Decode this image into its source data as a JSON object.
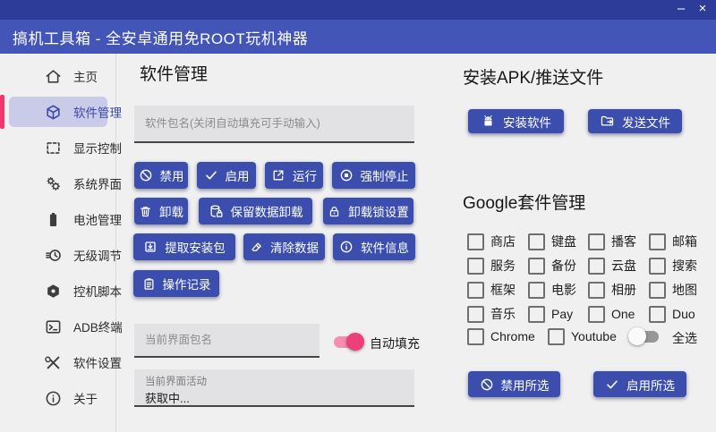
{
  "window": {
    "title": "搞机工具箱 - 全安卓通用免ROOT玩机神器",
    "minimize": "–",
    "close": "×"
  },
  "sidebar": {
    "items": [
      {
        "label": "主页"
      },
      {
        "label": "软件管理"
      },
      {
        "label": "显示控制"
      },
      {
        "label": "系统界面"
      },
      {
        "label": "电池管理"
      },
      {
        "label": "无级调节"
      },
      {
        "label": "控机脚本"
      },
      {
        "label": "ADB终端"
      },
      {
        "label": "软件设置"
      },
      {
        "label": "关于"
      }
    ]
  },
  "software": {
    "title": "软件管理",
    "package_placeholder": "软件包名(关闭自动填充可手动输入)",
    "btn_disable": "禁用",
    "btn_enable": "启用",
    "btn_run": "运行",
    "btn_force_stop": "强制停止",
    "btn_uninstall": "卸载",
    "btn_keep_data_uninstall": "保留数据卸载",
    "btn_uninstall_lock": "卸载锁设置",
    "btn_extract_apk": "提取安装包",
    "btn_clear_data": "清除数据",
    "btn_app_info": "软件信息",
    "btn_op_log": "操作记录",
    "current_package_placeholder": "当前界面包名",
    "autofill_label": "自动填充",
    "current_activity_label": "当前界面活动",
    "current_activity_value": "获取中..."
  },
  "push": {
    "title": "安装APK/推送文件",
    "btn_install": "安装软件",
    "btn_send": "发送文件"
  },
  "google": {
    "title": "Google套件管理",
    "items": [
      "商店",
      "键盘",
      "播客",
      "邮箱",
      "服务",
      "备份",
      "云盘",
      "搜索",
      "框架",
      "电影",
      "相册",
      "地图",
      "音乐",
      "Pay",
      "One",
      "Duo",
      "Chrome",
      "Youtube"
    ],
    "select_all_label": "全选",
    "btn_disable_selected": "禁用所选",
    "btn_enable_selected": "启用所选"
  },
  "colors": {
    "accent": "#3c4ead",
    "titlebar_top": "#2e3c99",
    "titlebar": "#4355b7",
    "selected_item_bg": "#c9cbe8",
    "selected_indicator": "#f1356d",
    "toggle_on": "#ec407a",
    "toggle_on_track": "#f48fb1",
    "toggle_off_track": "#979797"
  }
}
